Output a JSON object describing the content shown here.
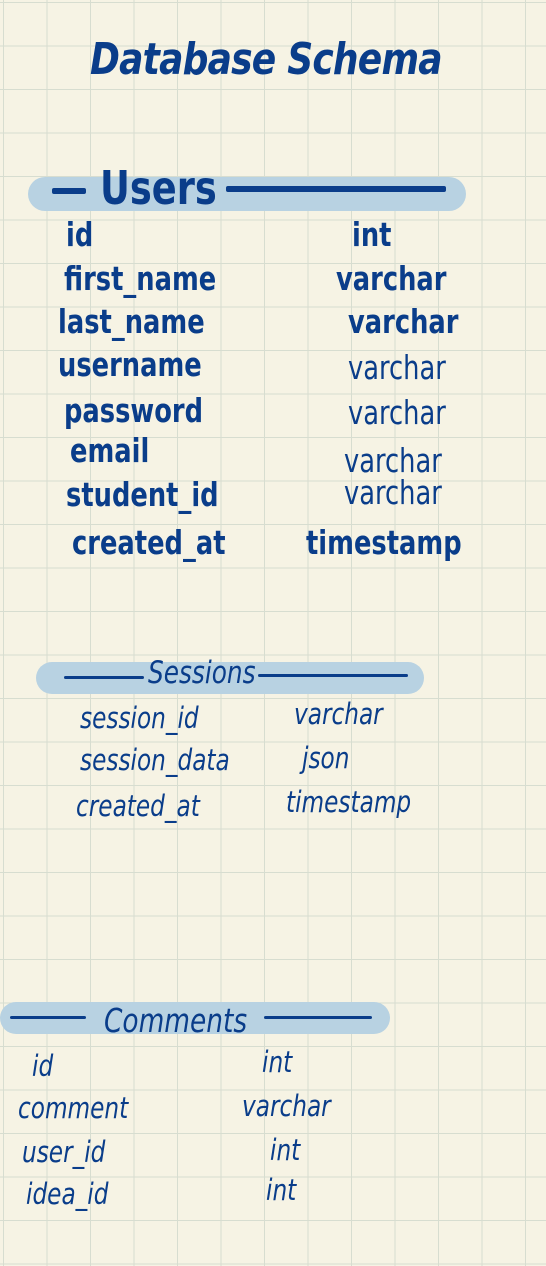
{
  "page": {
    "title": "Database  Schema"
  },
  "tables": [
    {
      "name": "Users",
      "columns": [
        {
          "field": "id",
          "type": "int"
        },
        {
          "field": "first_name",
          "type": "varchar"
        },
        {
          "field": "last_name",
          "type": "varchar"
        },
        {
          "field": "username",
          "type": "varchar"
        },
        {
          "field": "password",
          "type": "varchar"
        },
        {
          "field": "email",
          "type": "varchar"
        },
        {
          "field": "student_id",
          "type": "varchar"
        },
        {
          "field": "created_at",
          "type": "timestamp"
        }
      ]
    },
    {
      "name": "Sessions",
      "columns": [
        {
          "field": "session_id",
          "type": "varchar"
        },
        {
          "field": "session_data",
          "type": "json"
        },
        {
          "field": "created_at",
          "type": "timestamp"
        }
      ]
    },
    {
      "name": "Comments",
      "columns": [
        {
          "field": "id",
          "type": "int"
        },
        {
          "field": "comment",
          "type": "varchar"
        },
        {
          "field": "user_id",
          "type": "int"
        },
        {
          "field": "idea_id",
          "type": "int"
        }
      ]
    }
  ],
  "colors": {
    "ink": "#0a3d8a",
    "highlight": "#b8d2e2",
    "paper": "#f6f3e4",
    "grid": "#d7ddd0"
  }
}
